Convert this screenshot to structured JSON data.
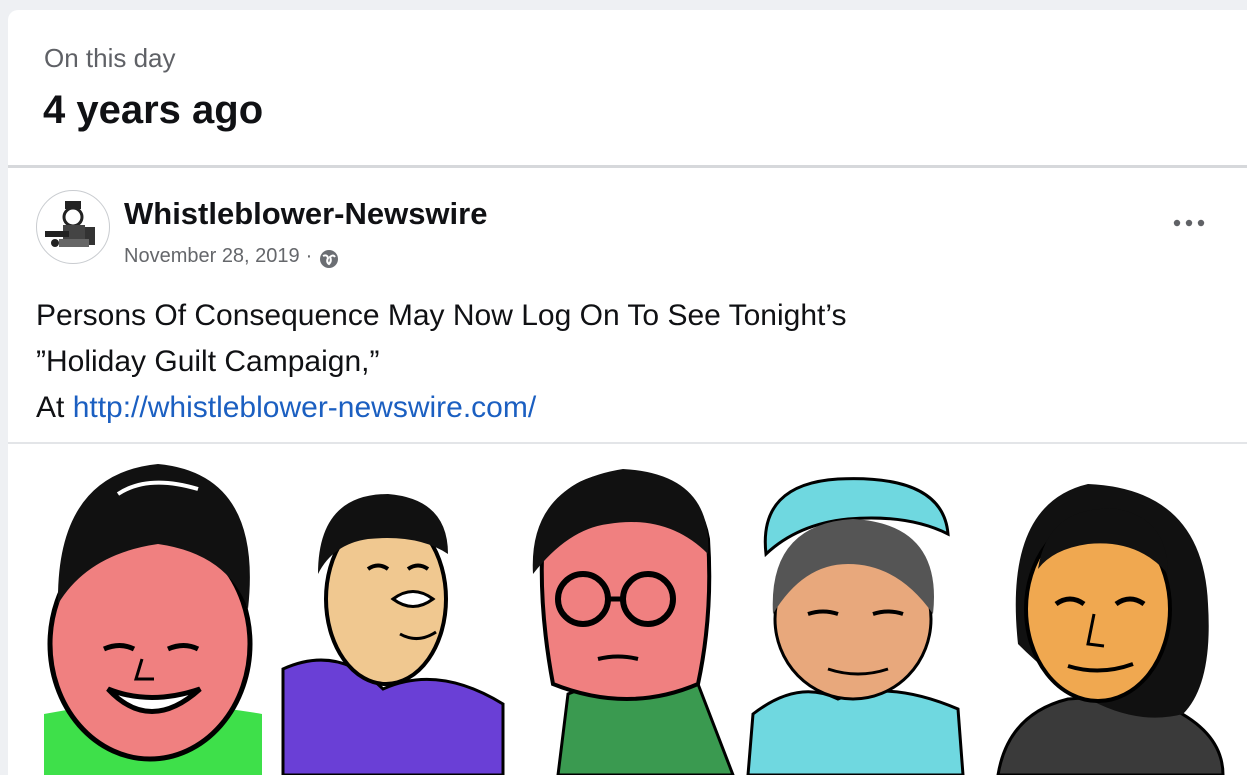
{
  "memories": {
    "subtitle": "On this day",
    "title": "4 years ago"
  },
  "post": {
    "author": "Whistleblower-Newswire",
    "date": "November 28, 2019",
    "separator": "·",
    "privacy_icon": "globe-icon",
    "more_icon": "more-horizontal-icon",
    "text_line1": "Persons Of Consequence May Now Log On To See Tonight’s",
    "text_line2": "”Holiday Guilt Campaign,”",
    "text_line3_prefix": "At ",
    "link_text": "http://whistleblower-newswire.com/",
    "image_description_icon": "portraits-image"
  },
  "colors": {
    "link": "#1b5fc1",
    "background": "#eef0f3",
    "card": "#ffffff",
    "face_pink": "#f08080",
    "shirt_green": "#3ee04a",
    "shirt_purple": "#6a3fd6",
    "face_tan": "#f0c890",
    "hat_cyan": "#6fd8e0",
    "face_orange": "#f0a850"
  }
}
